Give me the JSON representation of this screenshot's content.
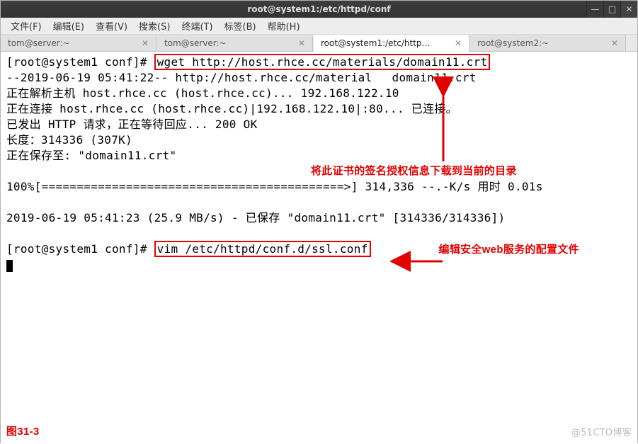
{
  "window": {
    "title": "root@system1:/etc/httpd/conf"
  },
  "menu": {
    "file": "文件(F)",
    "edit": "编辑(E)",
    "view": "查看(V)",
    "search": "搜索(S)",
    "terminal": "终端(T)",
    "tabs": "标签(B)",
    "help": "帮助(H)"
  },
  "tabs": [
    {
      "label": "tom@server:~"
    },
    {
      "label": "tom@server:~"
    },
    {
      "label": "root@system1:/etc/http…",
      "active": true
    },
    {
      "label": "root@system2:~"
    }
  ],
  "term": {
    "prompt1": "[root@system1 conf]#",
    "cmd1": "wget http://host.rhce.cc/materials/domain11.crt",
    "l2": "--2019-06-19 05:41:22--  http://host.rhce.cc/material",
    "l2b": "domain11.crt",
    "l3": "正在解析主机 host.rhce.cc (host.rhce.cc)... 192.168.122.10",
    "l4": "正在连接 host.rhce.cc (host.rhce.cc)|192.168.122.10|:80... 已连接。",
    "l5": "已发出 HTTP 请求，正在等待回应... 200 OK",
    "l6": "长度：314336 (307K)",
    "l7": "正在保存至: \"domain11.crt\"",
    "l8": "100%[===========================================>] 314,336     --.-K/s 用时 0.01s",
    "l9": "2019-06-19 05:41:23 (25.9 MB/s) - 已保存 \"domain11.crt\" [314336/314336])",
    "prompt2": "[root@system1 conf]#",
    "cmd2": "vim /etc/httpd/conf.d/ssl.conf"
  },
  "annotations": {
    "a1": "将此证书的签名授权信息下载到当前的目录",
    "a2": "编辑安全web服务的配置文件",
    "fig": "图31-3",
    "wm": "@51CTO博客"
  }
}
